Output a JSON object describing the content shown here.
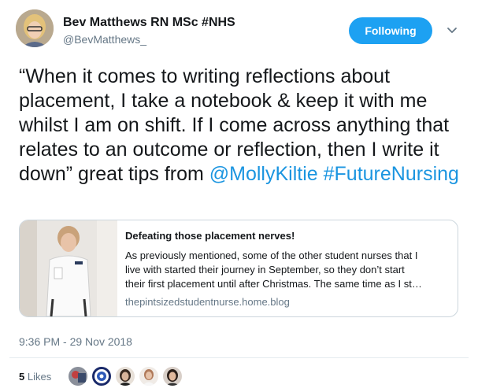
{
  "author": {
    "display_name": "Bev Matthews RN MSc #NHS",
    "handle": "@BevMatthews_"
  },
  "follow_button": {
    "label": "Following"
  },
  "tweet": {
    "text_part1": "“When it comes to writing reflections about placement, I take a notebook & keep it with me whilst I am on shift. If I come across anything that relates to an outcome or reflection, then I write it down” great tips from ",
    "mention": "@MollyKiltie",
    "space": " ",
    "hashtag": "#FutureNursing"
  },
  "card": {
    "title": "Defeating those placement nerves!",
    "description_lines": [
      "As previously mentioned, some of the other student nurses that I",
      "live with started their journey in September, so they don’t start",
      "their first placement until after Christmas. The same time as I st…"
    ],
    "domain": "thepintsizedstudentnurse.home.blog"
  },
  "timestamp": "9:36 PM - 29 Nov 2018",
  "likes": {
    "count": "5",
    "label": "Likes"
  },
  "colors": {
    "accent": "#1da1f2",
    "link": "#1b95e0",
    "muted": "#657786"
  },
  "icons": {
    "menu": "chevron-down-icon"
  }
}
